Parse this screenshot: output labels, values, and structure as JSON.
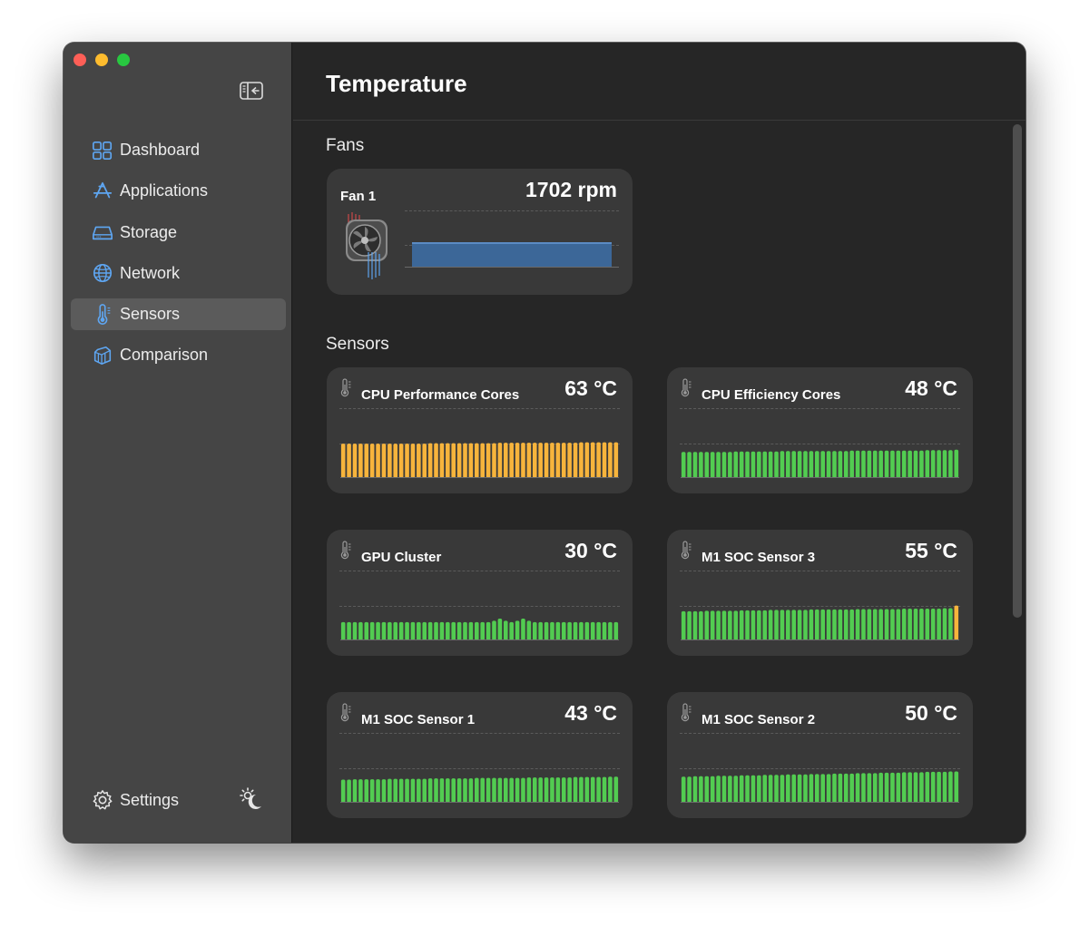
{
  "window": {
    "controls": [
      "close",
      "minimize",
      "zoom"
    ]
  },
  "sidebar": {
    "toggle_icon": "sidebar-collapse-icon",
    "items": [
      {
        "label": "Dashboard",
        "icon": "dashboard-icon",
        "active": false
      },
      {
        "label": "Applications",
        "icon": "app-store-icon",
        "active": false
      },
      {
        "label": "Storage",
        "icon": "drive-icon",
        "active": false
      },
      {
        "label": "Network",
        "icon": "globe-icon",
        "active": false
      },
      {
        "label": "Sensors",
        "icon": "thermometer-icon",
        "active": true
      },
      {
        "label": "Comparison",
        "icon": "cube-icon",
        "active": false
      }
    ],
    "settings_label": "Settings",
    "theme_icon": "sun-moon-icon"
  },
  "main": {
    "title": "Temperature",
    "fans_heading": "Fans",
    "sensors_heading": "Sensors",
    "fans": [
      {
        "name": "Fan 1",
        "value": "1702 rpm",
        "level": 0.35
      }
    ],
    "sensors": [
      {
        "name": "CPU Performance Cores",
        "value": "63 °C",
        "color": "#f7b43c",
        "history": [
          0.79,
          0.79,
          0.79,
          0.79,
          0.79,
          0.79,
          0.79,
          0.79,
          0.79,
          0.79,
          0.79,
          0.79,
          0.79,
          0.79,
          0.79,
          0.8,
          0.8,
          0.8,
          0.8,
          0.8,
          0.8,
          0.8,
          0.8,
          0.8,
          0.8,
          0.8,
          0.8,
          0.81,
          0.81,
          0.81,
          0.81,
          0.81,
          0.81,
          0.81,
          0.81,
          0.81,
          0.81,
          0.81,
          0.81,
          0.81,
          0.81,
          0.82,
          0.82,
          0.82,
          0.82,
          0.82,
          0.82,
          0.82
        ],
        "highlight": []
      },
      {
        "name": "CPU Efficiency Cores",
        "value": "48 °C",
        "color": "#52cc51",
        "history": [
          0.6,
          0.6,
          0.6,
          0.6,
          0.6,
          0.6,
          0.6,
          0.6,
          0.6,
          0.61,
          0.61,
          0.61,
          0.61,
          0.61,
          0.61,
          0.61,
          0.61,
          0.62,
          0.62,
          0.62,
          0.62,
          0.62,
          0.62,
          0.62,
          0.62,
          0.62,
          0.62,
          0.62,
          0.62,
          0.63,
          0.63,
          0.63,
          0.63,
          0.63,
          0.63,
          0.63,
          0.63,
          0.63,
          0.63,
          0.63,
          0.63,
          0.63,
          0.64,
          0.64,
          0.64,
          0.64,
          0.64,
          0.65
        ],
        "highlight": []
      },
      {
        "name": "GPU Cluster",
        "value": "30 °C",
        "color": "#52cc51",
        "history": [
          0.42,
          0.42,
          0.42,
          0.42,
          0.42,
          0.42,
          0.42,
          0.42,
          0.42,
          0.42,
          0.42,
          0.42,
          0.42,
          0.42,
          0.42,
          0.42,
          0.42,
          0.42,
          0.42,
          0.42,
          0.42,
          0.42,
          0.42,
          0.42,
          0.42,
          0.42,
          0.45,
          0.5,
          0.45,
          0.42,
          0.45,
          0.5,
          0.45,
          0.42,
          0.42,
          0.42,
          0.42,
          0.42,
          0.42,
          0.42,
          0.42,
          0.42,
          0.42,
          0.42,
          0.42,
          0.42,
          0.42,
          0.42
        ],
        "highlight": []
      },
      {
        "name": "M1 SOC Sensor 3",
        "value": "55 °C",
        "color": "#52cc51",
        "history": [
          0.67,
          0.67,
          0.67,
          0.67,
          0.68,
          0.68,
          0.68,
          0.68,
          0.68,
          0.68,
          0.69,
          0.69,
          0.69,
          0.69,
          0.69,
          0.7,
          0.7,
          0.7,
          0.7,
          0.7,
          0.7,
          0.7,
          0.71,
          0.71,
          0.71,
          0.71,
          0.71,
          0.71,
          0.71,
          0.71,
          0.72,
          0.72,
          0.72,
          0.72,
          0.72,
          0.72,
          0.72,
          0.72,
          0.73,
          0.73,
          0.73,
          0.73,
          0.73,
          0.73,
          0.73,
          0.74,
          0.74,
          0.8
        ],
        "highlight": [
          47
        ],
        "highlight_color": "#f7b43c"
      },
      {
        "name": "M1 SOC Sensor 1",
        "value": "43 °C",
        "color": "#52cc51",
        "history": [
          0.53,
          0.53,
          0.54,
          0.54,
          0.54,
          0.54,
          0.54,
          0.54,
          0.55,
          0.55,
          0.55,
          0.55,
          0.55,
          0.55,
          0.55,
          0.56,
          0.56,
          0.56,
          0.56,
          0.56,
          0.56,
          0.56,
          0.56,
          0.57,
          0.57,
          0.57,
          0.57,
          0.57,
          0.57,
          0.57,
          0.57,
          0.57,
          0.58,
          0.58,
          0.58,
          0.58,
          0.58,
          0.58,
          0.58,
          0.58,
          0.59,
          0.59,
          0.59,
          0.59,
          0.59,
          0.59,
          0.6,
          0.6
        ],
        "highlight": []
      },
      {
        "name": "M1 SOC Sensor 2",
        "value": "50 °C",
        "color": "#52cc51",
        "history": [
          0.6,
          0.6,
          0.61,
          0.61,
          0.61,
          0.61,
          0.62,
          0.62,
          0.62,
          0.62,
          0.63,
          0.63,
          0.63,
          0.63,
          0.64,
          0.64,
          0.64,
          0.64,
          0.65,
          0.65,
          0.65,
          0.65,
          0.66,
          0.66,
          0.66,
          0.66,
          0.67,
          0.67,
          0.67,
          0.67,
          0.68,
          0.68,
          0.68,
          0.68,
          0.69,
          0.69,
          0.69,
          0.69,
          0.7,
          0.7,
          0.7,
          0.7,
          0.71,
          0.71,
          0.71,
          0.71,
          0.72,
          0.72
        ],
        "highlight": []
      }
    ]
  }
}
